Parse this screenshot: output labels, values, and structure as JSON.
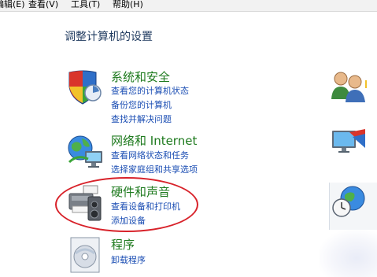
{
  "menubar": {
    "items": [
      "编辑(E)",
      "查看(V)",
      "工具(T)",
      "帮助(H)"
    ]
  },
  "main": {
    "title": "调整计算机的设置",
    "categories": [
      {
        "title": "系统和安全",
        "links": [
          "查看您的计算机状态",
          "备份您的计算机",
          "查找并解决问题"
        ],
        "icon": "security-shield-icon"
      },
      {
        "title": "网络和 Internet",
        "links": [
          "查看网络状态和任务",
          "选择家庭组和共享选项"
        ],
        "icon": "network-globe-icon"
      },
      {
        "title": "硬件和声音",
        "links": [
          "查看设备和打印机",
          "添加设备"
        ],
        "icon": "printer-speaker-icon"
      },
      {
        "title": "程序",
        "links": [
          "卸载程序"
        ],
        "icon": "programs-icon"
      }
    ]
  },
  "annotation": {
    "highlight_color": "#d8222a",
    "highlighted_category": "硬件和声音"
  },
  "colors": {
    "category_title": "#1e7a1e",
    "link": "#1a4db3",
    "page_title": "#1f3a5f"
  }
}
